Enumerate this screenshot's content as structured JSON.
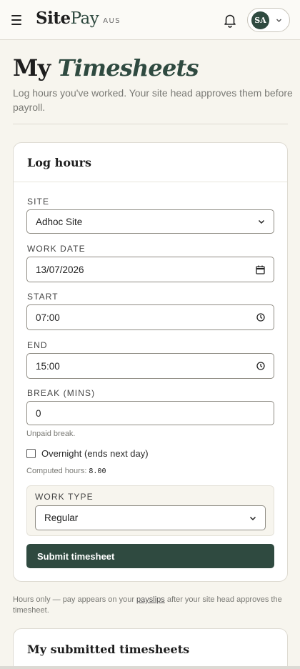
{
  "header": {
    "brand_first": "Site",
    "brand_second": "Pay",
    "region": "AUS",
    "avatar_initials": "SA",
    "icons": [
      "hamburger-menu-icon",
      "bell-icon",
      "chevron-down-icon"
    ]
  },
  "page": {
    "title_plain": "My",
    "title_italic": "Timesheets",
    "subtitle": "Log hours you've worked. Your site head approves them before payroll."
  },
  "log_hours": {
    "title": "Log hours",
    "site": {
      "label": "SITE",
      "value": "Adhoc Site"
    },
    "work_date": {
      "label": "WORK DATE",
      "value": "13/07/2026"
    },
    "start": {
      "label": "START",
      "value": "07:00"
    },
    "end": {
      "label": "END",
      "value": "15:00"
    },
    "break": {
      "label": "BREAK (MINS)",
      "value": "0",
      "hint": "Unpaid break."
    },
    "overnight": {
      "label": "Overnight (ends next day)",
      "checked": false
    },
    "computed": {
      "label": "Computed hours:",
      "value": "8.00"
    },
    "work_type": {
      "label": "WORK TYPE",
      "value": "Regular"
    },
    "submit_label": "Submit timesheet"
  },
  "footnote": {
    "before": "Hours only — pay appears on your",
    "link": "payslips",
    "after": "after your site head approves the timesheet."
  },
  "submitted": {
    "title": "My submitted timesheets"
  },
  "colors": {
    "accent": "#2f4a40",
    "background": "#f7f5ee"
  }
}
